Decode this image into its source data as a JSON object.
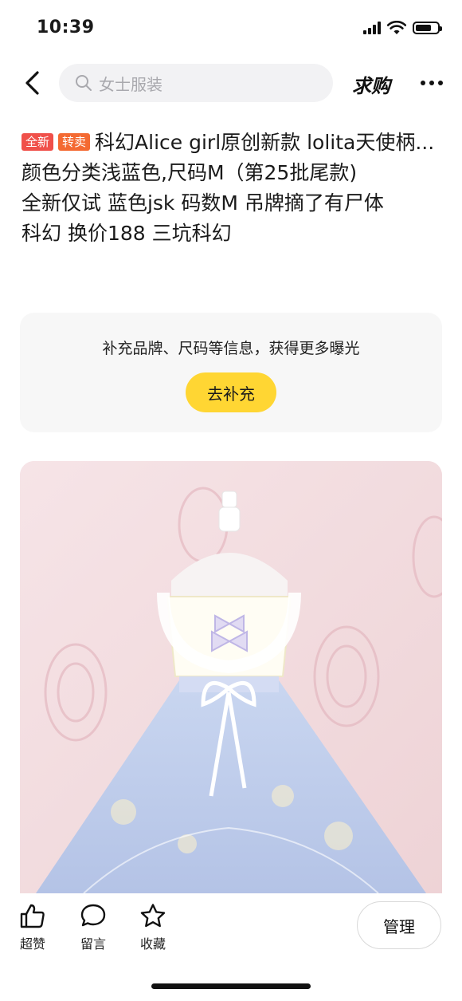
{
  "status": {
    "time": "10:39"
  },
  "nav": {
    "search_placeholder": "女士服装",
    "qiugou_label": "求购"
  },
  "listing": {
    "tag_new": "全新",
    "tag_resale": "转卖",
    "title": "科幻Alice girl原创新款 lolita天使柄...",
    "lines": [
      "颜色分类浅蓝色,尺码M（第25批尾款)",
      "全新仅试 蓝色jsk 码数M 吊牌摘了有尸体",
      "科幻 换价188 三坑科幻"
    ]
  },
  "supplement": {
    "text": "补充品牌、尺码等信息，获得更多曝光",
    "button_label": "去补充"
  },
  "bottom": {
    "like_label": "超赞",
    "comment_label": "留言",
    "favorite_label": "收藏",
    "manage_label": "管理"
  },
  "icons": {
    "back": "chevron-left-icon",
    "search": "search-icon",
    "more": "more-dots-icon",
    "like": "thumbs-up-icon",
    "comment": "comment-bubble-icon",
    "favorite": "star-icon"
  },
  "colors": {
    "tag_new": "#f0504a",
    "tag_resale": "#f46a32",
    "supplement_button": "#ffd633",
    "search_bg": "#f2f2f4"
  }
}
